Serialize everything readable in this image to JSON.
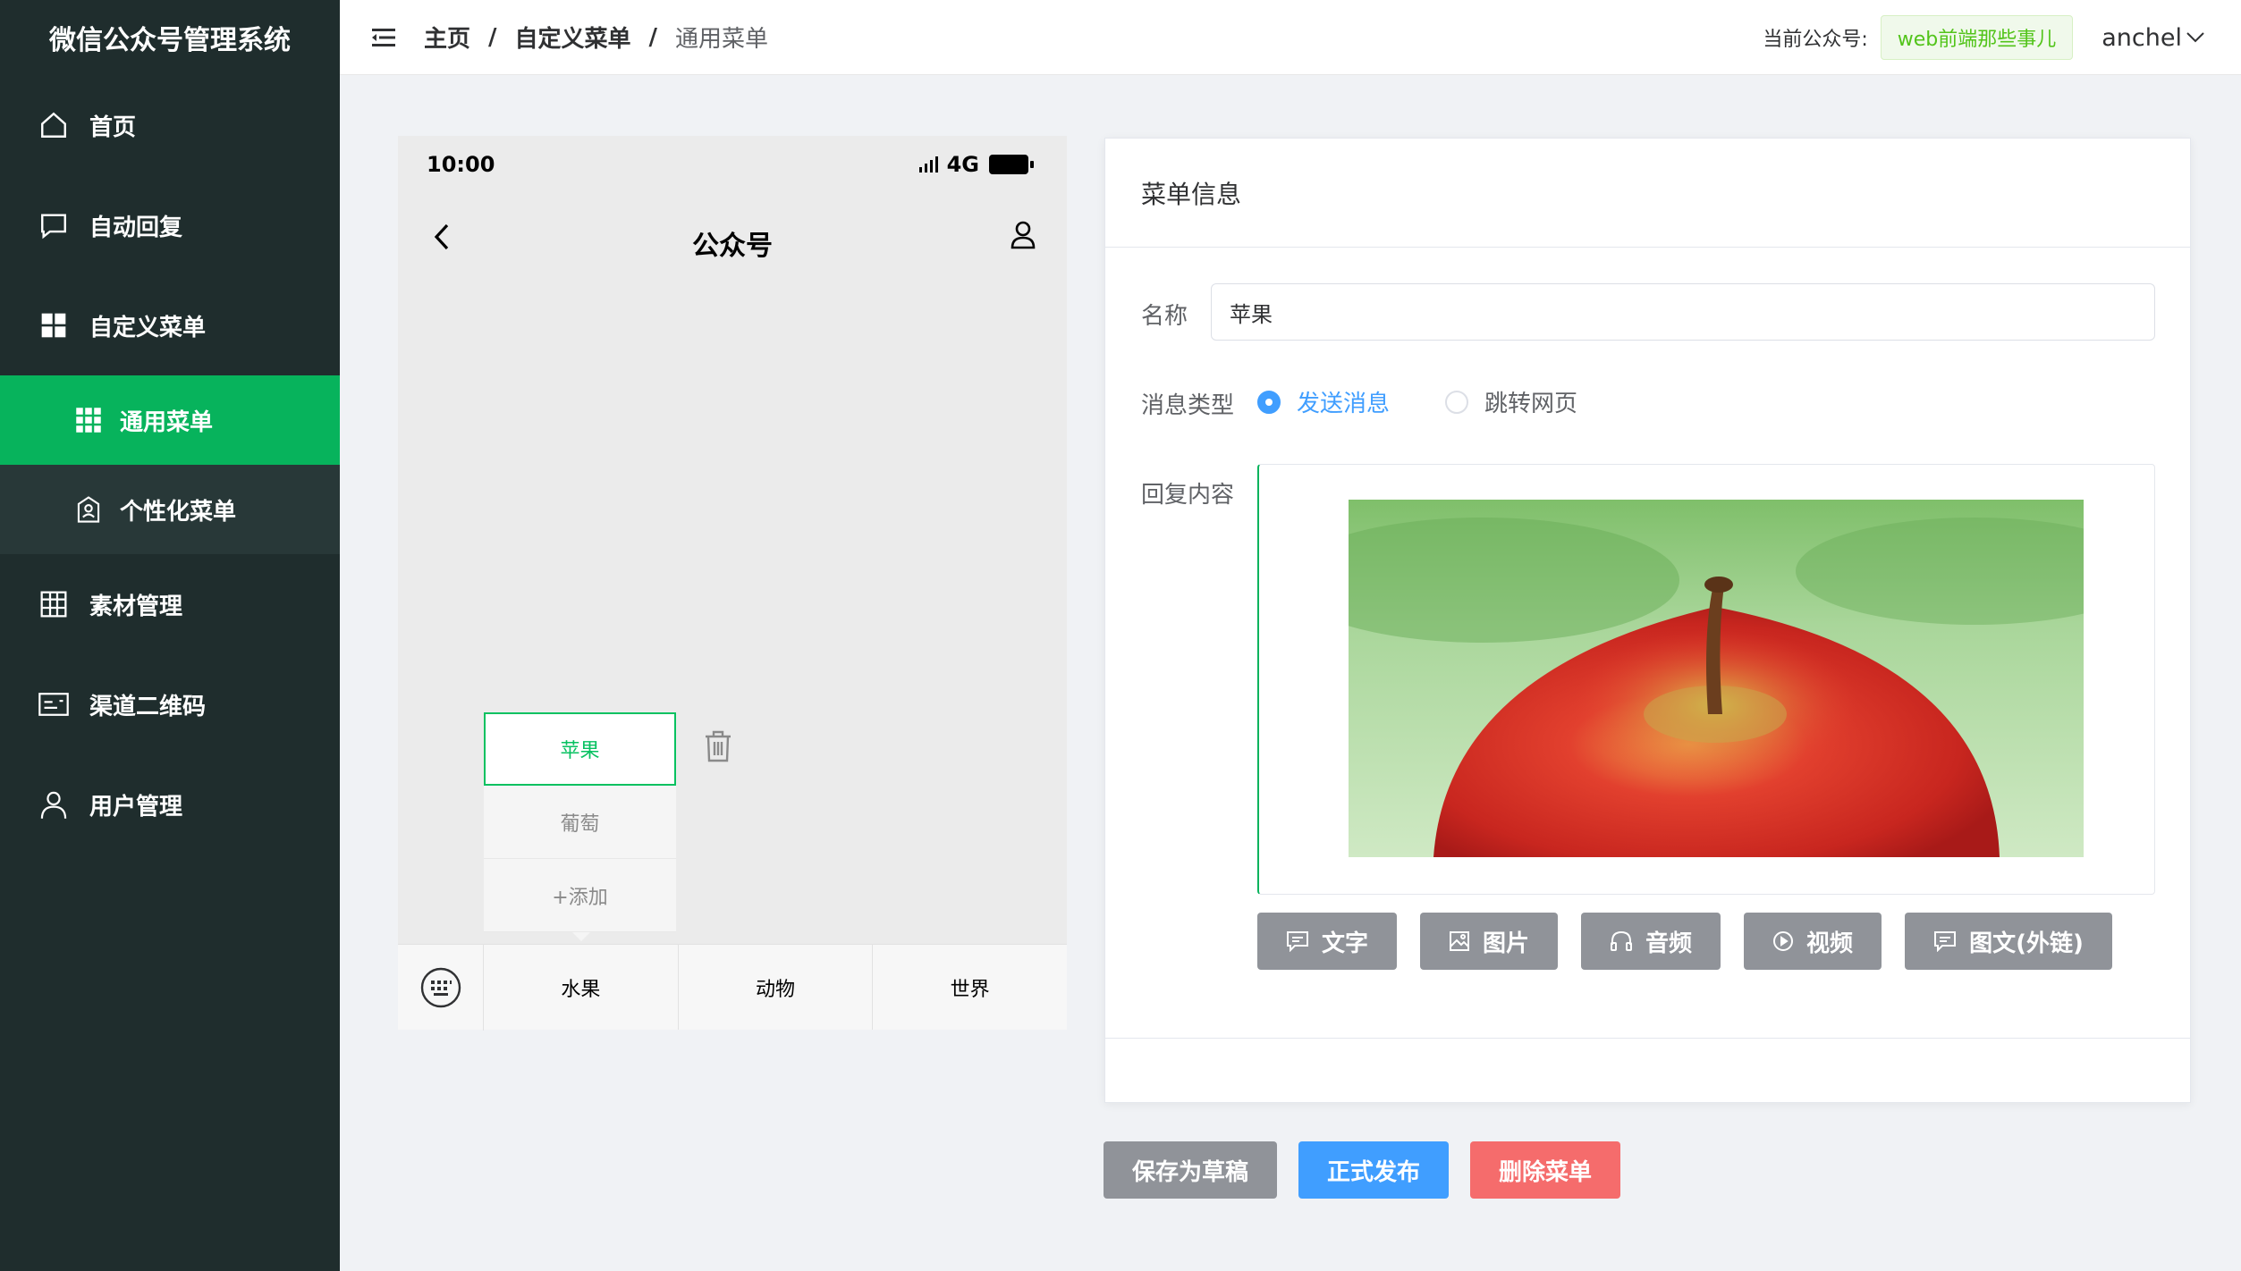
{
  "app": {
    "title": "微信公众号管理系统"
  },
  "sidebar": {
    "items": [
      {
        "label": "首页",
        "icon": "home-icon"
      },
      {
        "label": "自动回复",
        "icon": "chat-icon"
      },
      {
        "label": "自定义菜单",
        "icon": "grid-icon"
      },
      {
        "label": "通用菜单",
        "icon": "apps-icon",
        "active": true
      },
      {
        "label": "个性化菜单",
        "icon": "badge-icon"
      },
      {
        "label": "素材管理",
        "icon": "table-icon"
      },
      {
        "label": "渠道二维码",
        "icon": "card-icon"
      },
      {
        "label": "用户管理",
        "icon": "user-icon"
      }
    ]
  },
  "header": {
    "breadcrumb": [
      "主页",
      "自定义菜单",
      "通用菜单"
    ],
    "separator": "/",
    "account_label": "当前公众号:",
    "account_name": "web前端那些事儿",
    "user": "anchel"
  },
  "phone": {
    "time": "10:00",
    "network": "4G",
    "title": "公众号",
    "submenu": [
      "苹果",
      "葡萄",
      "+添加"
    ],
    "menu_tabs": [
      "水果",
      "动物",
      "世界"
    ]
  },
  "panel": {
    "title": "菜单信息",
    "name_label": "名称",
    "name_value": "苹果",
    "type_label": "消息类型",
    "type_options": [
      "发送消息",
      "跳转网页"
    ],
    "type_selected": "发送消息",
    "reply_label": "回复内容",
    "reply_buttons": [
      "文字",
      "图片",
      "音频",
      "视频",
      "图文(外链)"
    ]
  },
  "actions": {
    "draft": "保存为草稿",
    "publish": "正式发布",
    "delete": "删除菜单"
  },
  "colors": {
    "sidebar": "#1f2d2d",
    "active": "#07b35c",
    "primary": "#409eff",
    "danger": "#f56c6c",
    "info": "#909399"
  }
}
